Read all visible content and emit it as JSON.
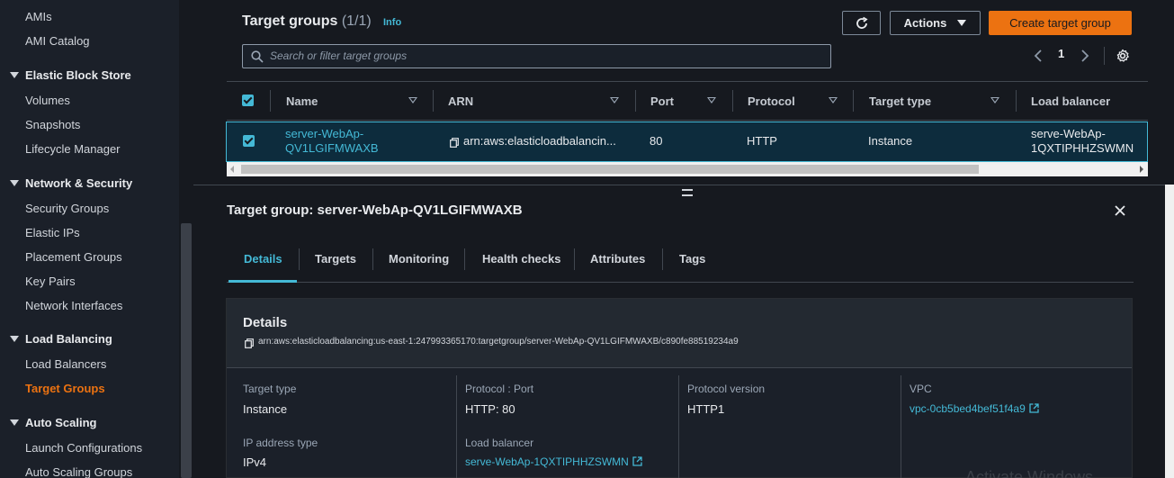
{
  "sidebar": {
    "items": [
      {
        "label": "AMIs",
        "type": "item"
      },
      {
        "label": "AMI Catalog",
        "type": "item"
      },
      {
        "label": "Elastic Block Store",
        "type": "section"
      },
      {
        "label": "Volumes",
        "type": "item"
      },
      {
        "label": "Snapshots",
        "type": "item"
      },
      {
        "label": "Lifecycle Manager",
        "type": "item"
      },
      {
        "label": "Network & Security",
        "type": "section"
      },
      {
        "label": "Security Groups",
        "type": "item"
      },
      {
        "label": "Elastic IPs",
        "type": "item"
      },
      {
        "label": "Placement Groups",
        "type": "item"
      },
      {
        "label": "Key Pairs",
        "type": "item"
      },
      {
        "label": "Network Interfaces",
        "type": "item"
      },
      {
        "label": "Load Balancing",
        "type": "section"
      },
      {
        "label": "Load Balancers",
        "type": "item"
      },
      {
        "label": "Target Groups",
        "type": "item",
        "active": true
      },
      {
        "label": "Auto Scaling",
        "type": "section"
      },
      {
        "label": "Launch Configurations",
        "type": "item"
      },
      {
        "label": "Auto Scaling Groups",
        "type": "item"
      }
    ]
  },
  "header": {
    "title": "Target groups",
    "count": "(1/1)",
    "info": "Info",
    "actions_label": "Actions",
    "create_label": "Create target group"
  },
  "search": {
    "placeholder": "Search or filter target groups"
  },
  "pagination": {
    "current_page": "1"
  },
  "table": {
    "columns": [
      "Name",
      "ARN",
      "Port",
      "Protocol",
      "Target type",
      "Load balancer"
    ],
    "row": {
      "name_line1": "server-WebAp-",
      "name_line2": "QV1LGIFMWAXB",
      "arn": "arn:aws:elasticloadbalancin...",
      "port": "80",
      "protocol": "HTTP",
      "target_type": "Instance",
      "lb_line1": "serve-WebAp-",
      "lb_line2": "1QXTIPHHZSWMN"
    }
  },
  "detail": {
    "title": "Target group: server-WebAp-QV1LGIFMWAXB",
    "tabs": [
      "Details",
      "Targets",
      "Monitoring",
      "Health checks",
      "Attributes",
      "Tags"
    ],
    "card_title": "Details",
    "arn": "arn:aws:elasticloadbalancing:us-east-1:247993365170:targetgroup/server-WebAp-QV1LGIFMWAXB/c890fe88519234a9",
    "fields": {
      "target_type_label": "Target type",
      "target_type_value": "Instance",
      "protocol_port_label": "Protocol : Port",
      "protocol_port_value": "HTTP: 80",
      "protocol_version_label": "Protocol version",
      "protocol_version_value": "HTTP1",
      "vpc_label": "VPC",
      "vpc_value": "vpc-0cb5bed4bef51f4a9",
      "ip_type_label": "IP address type",
      "ip_type_value": "IPv4",
      "lb_label": "Load balancer",
      "lb_value": "serve-WebAp-1QXTIPHHZSWMN"
    }
  },
  "watermark": "Activate Windows",
  "colors": {
    "accent": "#44b9d6",
    "primary": "#ec7211",
    "background": "#16191f"
  }
}
